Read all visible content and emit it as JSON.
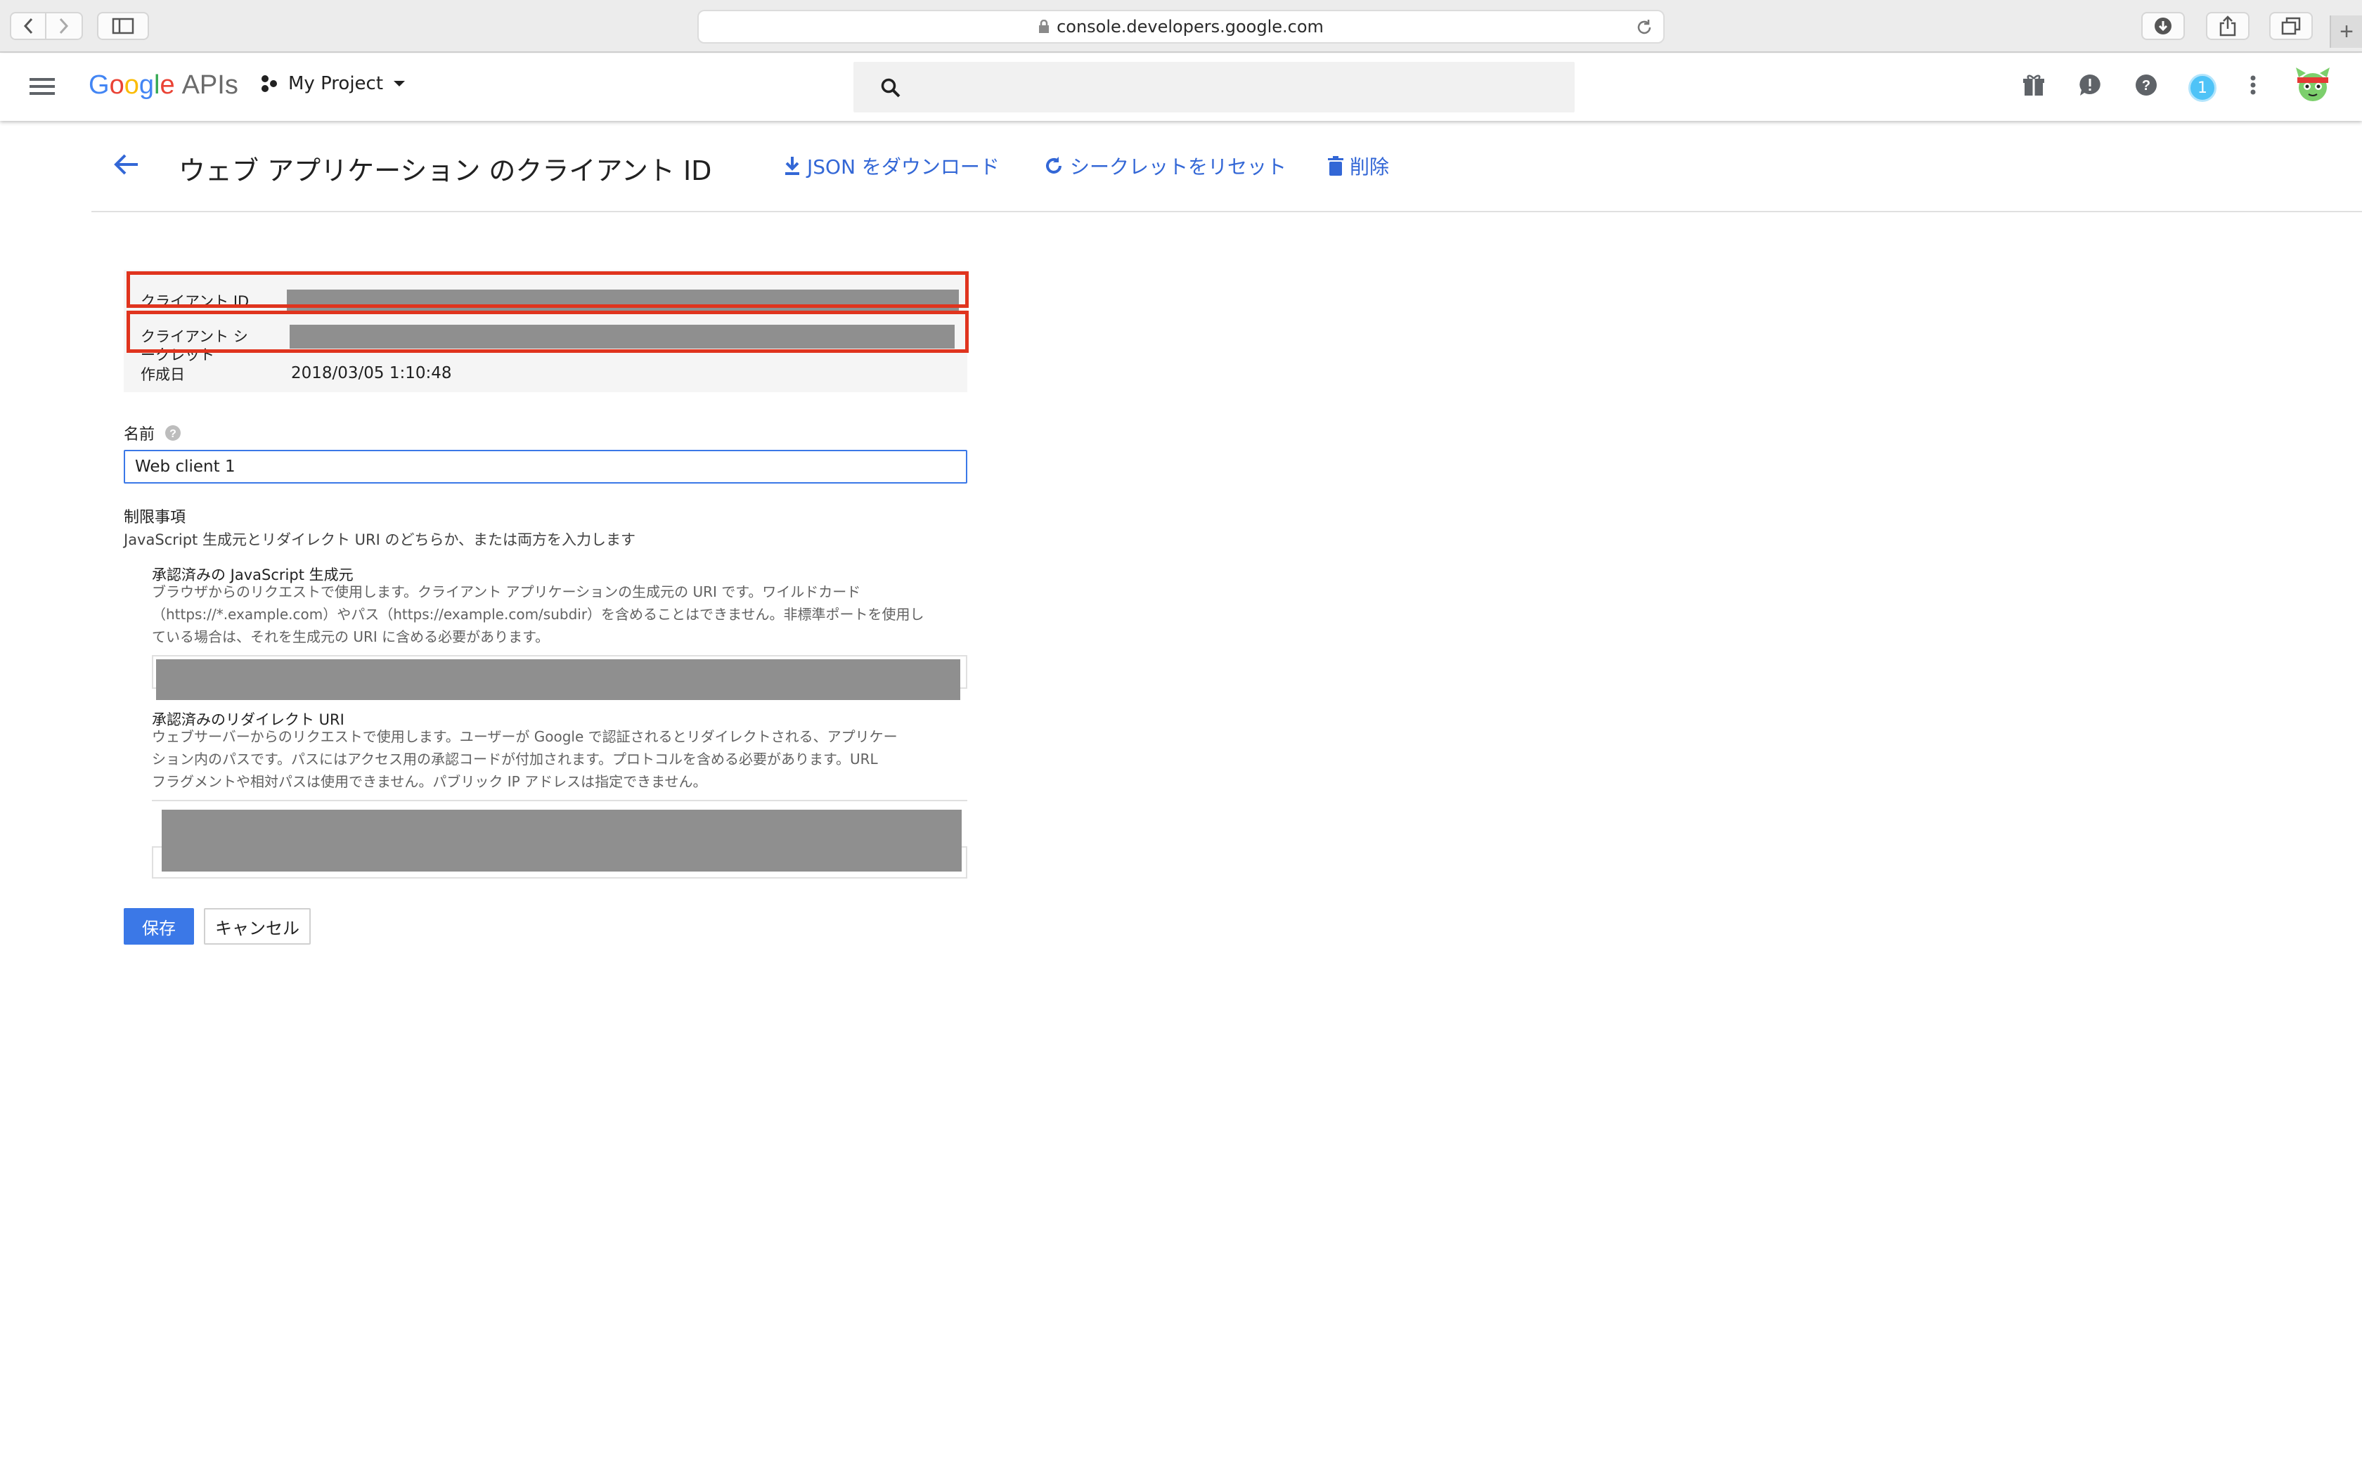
{
  "browser": {
    "url": "console.developers.google.com",
    "new_tab_label": "+"
  },
  "header": {
    "logo": {
      "g": "G",
      "o1": "o",
      "o2": "o",
      "g2": "g",
      "l": "l",
      "e": "e",
      "apis": "APIs"
    },
    "project_name": "My Project",
    "notification_count": "1"
  },
  "title_bar": {
    "title": "ウェブ アプリケーション のクライアント ID",
    "download_json": "JSON をダウンロード",
    "reset_secret": "シークレットをリセット",
    "delete": "削除"
  },
  "info": {
    "client_id_label": "クライアント ID",
    "client_secret_label_line1": "クライアント シ",
    "client_secret_label_line2": "ークレット",
    "created_label": "作成日",
    "created_value": "2018/03/05 1:10:48"
  },
  "form": {
    "name_label": "名前",
    "name_value": "Web client 1",
    "restrictions_title": "制限事項",
    "restrictions_desc": "JavaScript 生成元とリダイレクト URI のどちらか、または両方を入力します",
    "js_origins": {
      "title": "承認済みの JavaScript 生成元",
      "desc_line1": "ブラウザからのリクエストで使用します。クライアント アプリケーションの生成元の URI です。ワイルドカード",
      "desc_line2": "（https://*.example.com）やパス（https://example.com/subdir）を含めることはできません。非標準ポートを使用し",
      "desc_line3": "ている場合は、それを生成元の URI に含める必要があります。"
    },
    "redirect_uris": {
      "title": "承認済みのリダイレクト URI",
      "desc_line1": "ウェブサーバーからのリクエストで使用します。ユーザーが Google で認証されるとリダイレクトされる、アプリケー",
      "desc_line2": "ション内のパスです。パスにはアクセス用の承認コードが付加されます。プロトコルを含める必要があります。URL",
      "desc_line3": "フラグメントや相対パスは使用できません。パブリック IP アドレスは指定できません。"
    },
    "save_label": "保存",
    "cancel_label": "キャンセル"
  },
  "colors": {
    "accent": "#3367d6",
    "highlight_border": "#e0341e",
    "mask": "#8f8f8f"
  }
}
